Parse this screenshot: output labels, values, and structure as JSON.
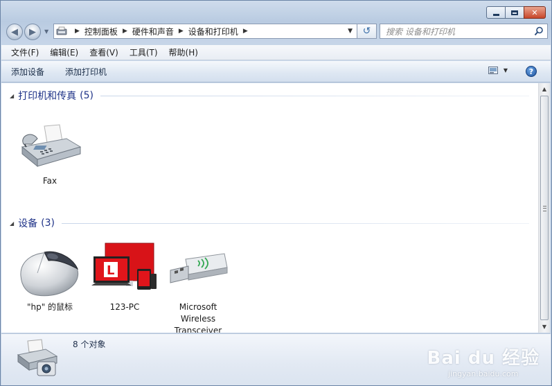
{
  "navigation": {
    "breadcrumbs": [
      "控制面板",
      "硬件和声音",
      "设备和打印机"
    ],
    "search_placeholder": "搜索 设备和打印机"
  },
  "menu": [
    "文件(F)",
    "编辑(E)",
    "查看(V)",
    "工具(T)",
    "帮助(H)"
  ],
  "commands": [
    "添加设备",
    "添加打印机"
  ],
  "groups": {
    "printers": {
      "title": "打印机和传真",
      "count": "(5)",
      "items": [
        {
          "label": "Fax",
          "icon": "fax-icon"
        }
      ]
    },
    "devices": {
      "title": "设备",
      "count": "(3)",
      "items": [
        {
          "label": "\"hp\" 的鼠标",
          "icon": "mouse-icon"
        },
        {
          "label": "123-PC",
          "icon": "computer-icon"
        },
        {
          "label": "Microsoft\nWireless\nTransceiver",
          "icon": "usb-transceiver-icon"
        }
      ]
    }
  },
  "details": {
    "summary": "8 个对象"
  },
  "watermark": {
    "main": "Bai du 经验",
    "sub": "jingyan.baidu.com"
  },
  "colors": {
    "group_title": "#1e3287",
    "computer_red": "#e0151b"
  }
}
